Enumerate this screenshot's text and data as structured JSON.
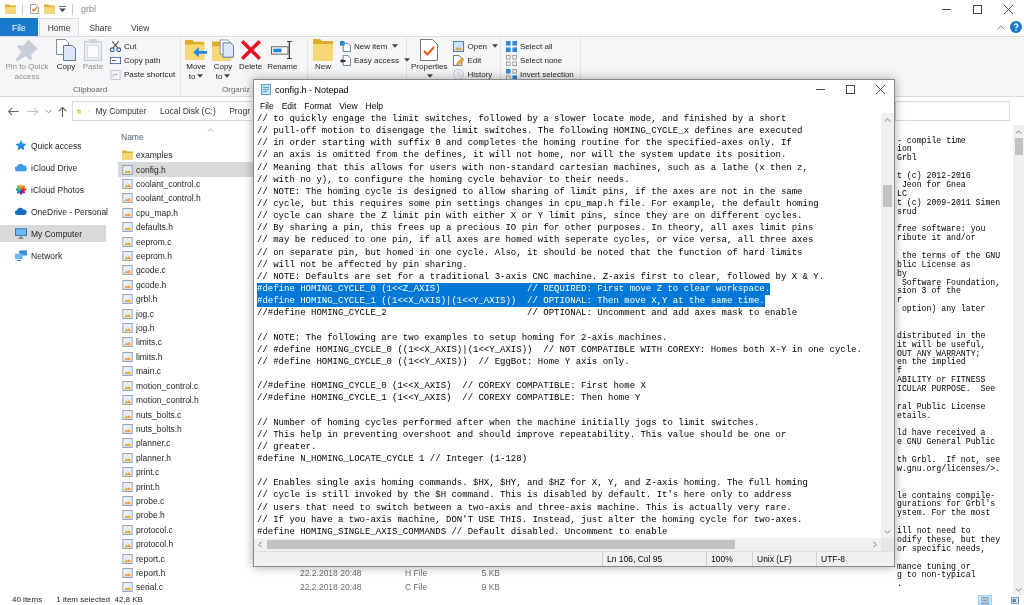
{
  "explorer": {
    "title": "grbl",
    "tabs": [
      {
        "label": "File",
        "kind": "file",
        "selected": false
      },
      {
        "label": "Home",
        "kind": "tab",
        "selected": true
      },
      {
        "label": "Share",
        "kind": "tab",
        "selected": false
      },
      {
        "label": "View",
        "kind": "tab",
        "selected": false
      }
    ],
    "ribbon_groups": [
      {
        "label": "Clipboard",
        "buttons": [
          {
            "kind": "large",
            "label": "Pin to Quick access",
            "disabled": true,
            "dropdown": false
          },
          {
            "kind": "large",
            "label": "Copy",
            "disabled": false,
            "dropdown": false
          },
          {
            "kind": "large",
            "label": "Paste",
            "disabled": true,
            "dropdown": false
          },
          {
            "kind": "small",
            "label": "Cut",
            "disabled": false,
            "dropdown": false
          },
          {
            "kind": "small",
            "label": "Copy path",
            "disabled": false,
            "dropdown": false
          },
          {
            "kind": "small",
            "label": "Paste shortcut",
            "disabled": true,
            "dropdown": false
          }
        ]
      },
      {
        "label": "Organiz",
        "buttons": [
          {
            "kind": "large",
            "label": "Move to",
            "disabled": false,
            "dropdown": true
          },
          {
            "kind": "large",
            "label": "Copy to",
            "disabled": false,
            "dropdown": true
          },
          {
            "kind": "large",
            "label": "Delete",
            "disabled": false,
            "dropdown": false
          },
          {
            "kind": "large",
            "label": "Rename",
            "disabled": false,
            "dropdown": false
          }
        ]
      },
      {
        "buttons": [
          {
            "kind": "large",
            "label": "New",
            "disabled": false,
            "dropdown": false
          },
          {
            "kind": "small",
            "label": "New item",
            "disabled": false,
            "dropdown": true
          },
          {
            "kind": "small",
            "label": "Easy access",
            "disabled": false,
            "dropdown": true
          }
        ]
      },
      {
        "buttons": [
          {
            "kind": "large",
            "label": "Properties",
            "disabled": false,
            "dropdown": true
          },
          {
            "kind": "small",
            "label": "Open",
            "disabled": false,
            "dropdown": true
          },
          {
            "kind": "small",
            "label": "Edit",
            "disabled": false,
            "dropdown": false
          },
          {
            "kind": "small",
            "label": "History",
            "disabled": true,
            "dropdown": false
          }
        ]
      },
      {
        "buttons": [
          {
            "kind": "small",
            "label": "Select all",
            "disabled": false,
            "dropdown": false
          },
          {
            "kind": "small",
            "label": "Select none",
            "disabled": false,
            "dropdown": false
          },
          {
            "kind": "small",
            "label": "Invert selection",
            "disabled": false,
            "dropdown": false
          }
        ]
      }
    ],
    "address": {
      "path": [
        "My Computer",
        "Local Disk (C:)",
        "Progr"
      ]
    },
    "nav_items": [
      {
        "label": "Quick access",
        "selected": false
      },
      {
        "label": "iCloud Drive",
        "selected": false
      },
      {
        "label": "iCloud Photos",
        "selected": false
      },
      {
        "label": "OneDrive - Personal",
        "selected": false
      },
      {
        "label": "My Computer",
        "selected": true
      },
      {
        "label": "Network",
        "selected": false
      }
    ],
    "column_header": "Name",
    "files": [
      {
        "name": "examples",
        "kind": "folder",
        "selected": false
      },
      {
        "name": "config.h",
        "kind": "file",
        "selected": true
      },
      {
        "name": "coolant_control.c",
        "kind": "file",
        "selected": false
      },
      {
        "name": "coolant_control.h",
        "kind": "file",
        "selected": false
      },
      {
        "name": "cpu_map.h",
        "kind": "file",
        "selected": false
      },
      {
        "name": "defaults.h",
        "kind": "file",
        "selected": false
      },
      {
        "name": "eeprom.c",
        "kind": "file",
        "selected": false
      },
      {
        "name": "eeprom.h",
        "kind": "file",
        "selected": false
      },
      {
        "name": "gcode.c",
        "kind": "file",
        "selected": false
      },
      {
        "name": "gcode.h",
        "kind": "file",
        "selected": false
      },
      {
        "name": "grbl.h",
        "kind": "file",
        "selected": false
      },
      {
        "name": "jog.c",
        "kind": "file",
        "selected": false
      },
      {
        "name": "jog.h",
        "kind": "file",
        "selected": false
      },
      {
        "name": "limits.c",
        "kind": "file",
        "selected": false
      },
      {
        "name": "limits.h",
        "kind": "file",
        "selected": false
      },
      {
        "name": "main.c",
        "kind": "file",
        "selected": false
      },
      {
        "name": "motion_control.c",
        "kind": "file",
        "selected": false
      },
      {
        "name": "motion_control.h",
        "kind": "file",
        "selected": false
      },
      {
        "name": "nuts_bolts.c",
        "kind": "file",
        "selected": false
      },
      {
        "name": "nuts_bolts.h",
        "kind": "file",
        "selected": false
      },
      {
        "name": "planner.c",
        "kind": "file",
        "selected": false
      },
      {
        "name": "planner.h",
        "kind": "file",
        "selected": false
      },
      {
        "name": "print.c",
        "kind": "file",
        "selected": false
      },
      {
        "name": "print.h",
        "kind": "file",
        "selected": false
      },
      {
        "name": "probe.c",
        "kind": "file",
        "selected": false
      },
      {
        "name": "probe.h",
        "kind": "file",
        "selected": false
      },
      {
        "name": "protocol.c",
        "kind": "file",
        "selected": false
      },
      {
        "name": "protocol.h",
        "kind": "file",
        "selected": false
      },
      {
        "name": "report.c",
        "kind": "file",
        "selected": false
      },
      {
        "name": "report.h",
        "kind": "file",
        "selected": false,
        "modified": "22.2.2018 20:48",
        "type": "H File",
        "size": "5 KB"
      },
      {
        "name": "serial.c",
        "kind": "file",
        "selected": false,
        "modified": "22.2.2018 20:48",
        "type": "C File",
        "size": "9 KB"
      }
    ],
    "preview_text": "- compile time\nion\nGrbl\n\nt (c) 2012-2016\n Jeon for Gnea\nLC\nt (c) 2009-2011 Simen\nsrud\n\nfree software: you\nribute it and/or\n\n the terms of the GNU\nblic License as\nby\n Software Foundation,\nsion 3 of the\nr\n option) any later\n\n\ndistributed in the\nit will be useful,\nOUT ANY WARRANTY;\nen the implied\nf\nABILITY or FITNESS\nICULAR PURPOSE.  See\n\nral Public License\netails.\n\nld have received a\ne GNU General Public\n\nth Grbl.  If not, see\nw.gnu.org/licenses/>.\n\n\nle contains compile-\ngurations for Grbl's\nystem. For the most\n\nill not need to\nodify these, but they\nor specific needs,\n\nmance tuning or\ng to non-typical\n.",
    "status_bar": {
      "items": "40 items",
      "selection": "1 item selected  42,8 KB",
      "view_buttons": [
        {
          "selected": true
        },
        {
          "selected": false
        }
      ]
    }
  },
  "notepad": {
    "title": "config.h - Notepad",
    "menu": [
      "File",
      "Edit",
      "Format",
      "View",
      "Help"
    ],
    "paragraphs": [
      {
        "lines": [
          {
            "text": "// to quickly engage the limit switches, followed by a slower locate mode, and finished by a short",
            "selected": false
          },
          {
            "text": "// pull-off motion to disengage the limit switches. The following HOMING_CYCLE_x defines are executed",
            "selected": false
          },
          {
            "text": "// in order starting with suffix 0 and completes the homing routine for the specified-axes only. If",
            "selected": false
          },
          {
            "text": "// an axis is omitted from the defines, it will not home, nor will the system update its position.",
            "selected": false
          },
          {
            "text": "// Meaning that this allows for users with non-standard cartesian machines, such as a lathe (x then z,",
            "selected": false
          },
          {
            "text": "// with no y), to configure the homing cycle behavior to their needs.",
            "selected": false
          },
          {
            "text": "// NOTE: The homing cycle is designed to allow sharing of limit pins, if the axes are not in the same",
            "selected": false
          },
          {
            "text": "// cycle, but this requires some pin settings changes in cpu_map.h file. For example, the default homing",
            "selected": false
          },
          {
            "text": "// cycle can share the Z limit pin with either X or Y limit pins, since they are on different cycles.",
            "selected": false
          },
          {
            "text": "// By sharing a pin, this frees up a precious IO pin for other purposes. In theory, all axes limit pins",
            "selected": false
          },
          {
            "text": "// may be reduced to one pin, if all axes are homed with seperate cycles, or vice versa, all three axes",
            "selected": false
          },
          {
            "text": "// on separate pin, but homed in one cycle. Also, it should be noted that the function of hard limits",
            "selected": false
          },
          {
            "text": "// will not be affected by pin sharing.",
            "selected": false
          },
          {
            "text": "// NOTE: Defaults are set for a traditional 3-axis CNC machine. Z-axis first to clear, followed by X & Y.",
            "selected": false
          },
          {
            "text": "#define HOMING_CYCLE_0 (1<<Z_AXIS)                // REQUIRED: First move Z to clear workspace.",
            "selected": true
          },
          {
            "text": "#define HOMING_CYCLE_1 ((1<<X_AXIS)|(1<<Y_AXIS))  // OPTIONAL: Then move X,Y at the same time.",
            "selected": true
          },
          {
            "text": "//#define HOMING_CYCLE_2                          // OPTIONAL: Uncomment and add axes mask to enable",
            "selected": false
          }
        ]
      },
      {
        "lines": [
          {
            "text": "// NOTE: The following are two examples to setup homing for 2-axis machines.",
            "selected": false
          },
          {
            "text": "// #define HOMING_CYCLE_0 ((1<<X_AXIS)|(1<<Y_AXIS))  // NOT COMPATIBLE WITH COREXY: Homes both X-Y in one cycle.",
            "selected": false
          },
          {
            "text": "// #define HOMING_CYCLE_0 ((1<<Y_AXIS))  // EggBot: Home Y axis only.",
            "selected": false
          }
        ]
      },
      {
        "lines": [
          {
            "text": "//#define HOMING_CYCLE_0 (1<<X_AXIS)  // COREXY COMPATIBLE: First home X",
            "selected": false
          },
          {
            "text": "//#define HOMING_CYCLE_1 (1<<Y_AXIS)  // COREXY COMPATIBLE: Then home Y",
            "selected": false
          }
        ]
      },
      {
        "lines": [
          {
            "text": "// Number of homing cycles performed after when the machine initially jogs to limit switches.",
            "selected": false
          },
          {
            "text": "// This help in preventing overshoot and should improve repeatability. This value should be one or",
            "selected": false
          },
          {
            "text": "// greater.",
            "selected": false
          },
          {
            "text": "#define N_HOMING_LOCATE_CYCLE 1 // Integer (1-128)",
            "selected": false
          }
        ]
      },
      {
        "lines": [
          {
            "text": "// Enables single axis homing commands. $HX, $HY, and $HZ for X, Y, and Z-axis homing. The full homing",
            "selected": false
          },
          {
            "text": "// cycle is still invoked by the $H command. This is disabled by default. It's here only to address",
            "selected": false
          },
          {
            "text": "// users that need to switch between a two-axis and three-axis machine. This is actually very rare.",
            "selected": false
          },
          {
            "text": "// If you have a two-axis machine, DON'T USE THIS. Instead, just alter the homing cycle for two-axes.",
            "selected": false
          },
          {
            "text": "#define HOMING_SINGLE_AXIS_COMMANDS // Default disabled. Uncomment to enable",
            "selected": false
          }
        ]
      }
    ],
    "status": [
      "Ln 106, Col 95",
      "100%",
      "Unix (LF)",
      "UTF-8"
    ]
  }
}
